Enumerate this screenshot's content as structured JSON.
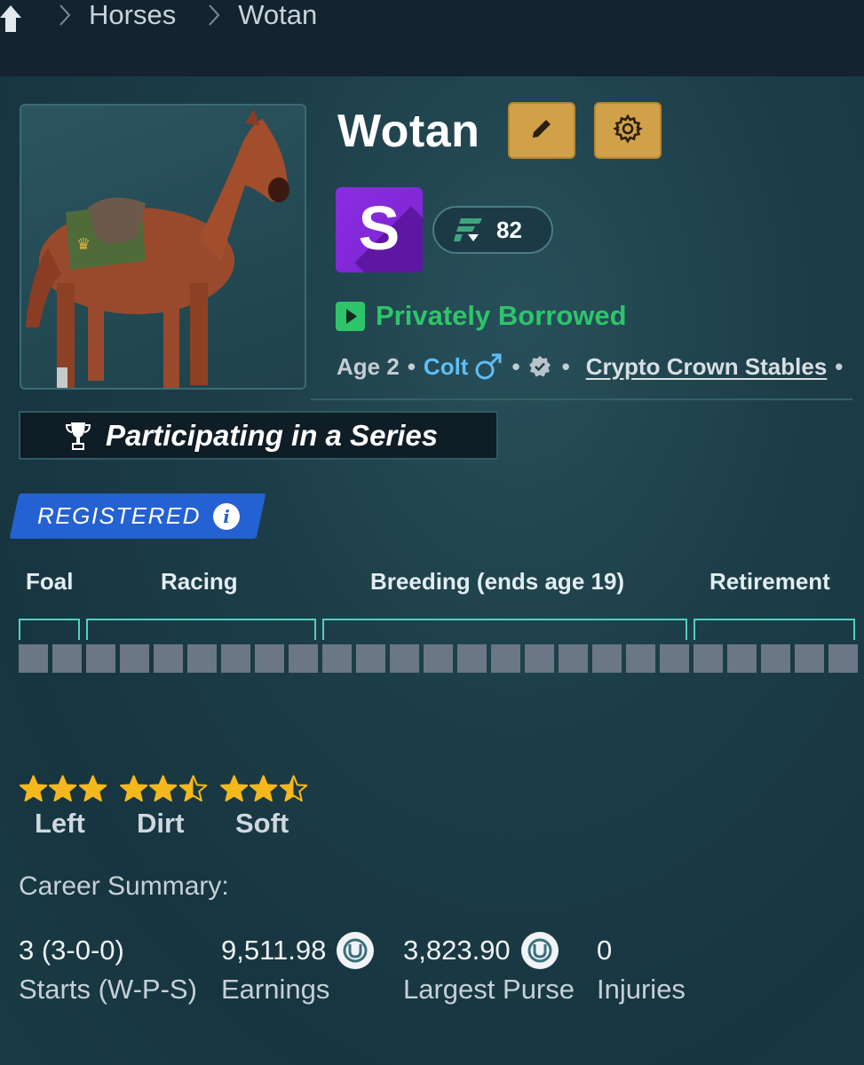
{
  "breadcrumb": {
    "home_icon": "home-icon",
    "items": [
      "Horses",
      "Wotan"
    ]
  },
  "horse": {
    "name": "Wotan",
    "grade": "S",
    "rating": "82",
    "status": "Privately Borrowed",
    "age": "Age 2",
    "sex": "Colt",
    "stable": "Crypto Crown Stables"
  },
  "actions": {
    "edit_icon": "pencil-icon",
    "settings_icon": "gear-icon"
  },
  "series_banner": "Participating in a Series",
  "registration": {
    "label": "REGISTERED",
    "info_glyph": "i"
  },
  "lifecycle": {
    "stages": [
      "Foal",
      "Racing",
      "Breeding (ends age 19)",
      "Retirement"
    ],
    "total_cells": 25,
    "filled_cells": 0
  },
  "preferences": [
    {
      "label": "Left",
      "stars": 3
    },
    {
      "label": "Dirt",
      "stars": 2.5
    },
    {
      "label": "Soft",
      "stars": 2.5
    }
  ],
  "career": {
    "title": "Career Summary:",
    "stats": [
      {
        "value": "3 (3-0-0)",
        "label": "Starts (W-P-S)",
        "coin": false
      },
      {
        "value": "9,511.98",
        "label": "Earnings",
        "coin": true
      },
      {
        "value": "3,823.90",
        "label": "Largest Purse",
        "coin": true
      },
      {
        "value": "0",
        "label": "Injuries",
        "coin": false
      }
    ]
  },
  "colors": {
    "accent_gold": "#d1a14a",
    "status_green": "#2ec56a",
    "grade_purple": "#8a2ee0",
    "registered_blue": "#2461d2",
    "bracket_teal": "#4fd2c4",
    "colt_blue": "#5fbef5"
  }
}
